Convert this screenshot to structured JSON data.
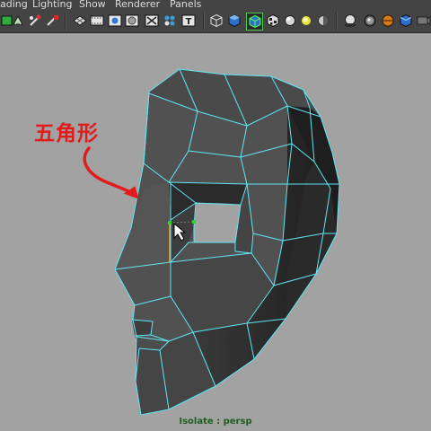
{
  "menu": {
    "items": [
      "ading",
      "Lighting",
      "Show",
      "Renderer",
      "Panels"
    ]
  },
  "toolbar": {
    "icons": [
      "select-camera-icon",
      "lock-camera-icon",
      "bookmark-icon",
      "image-plane-icon",
      "grid-icon",
      "film-gate-icon",
      "resolution-gate-icon",
      "gate-mask-icon",
      "field-chart-icon",
      "safe-action-icon",
      "safe-title-icon",
      "wireframe-icon",
      "smooth-shade-icon",
      "wireframe-on-shaded-icon",
      "textured-icon",
      "use-default-material-icon",
      "lights-icon",
      "shadows-icon",
      "render-icon",
      "isolate-icon",
      "xray-icon"
    ]
  },
  "annotation": {
    "label": "五角形"
  },
  "status": {
    "isolate": "Isolate : persp"
  },
  "colors": {
    "wire": "#5fe6f5",
    "arrow": "#e21b1b",
    "selection": "#e8a040",
    "vertex": "#2bd62b"
  }
}
